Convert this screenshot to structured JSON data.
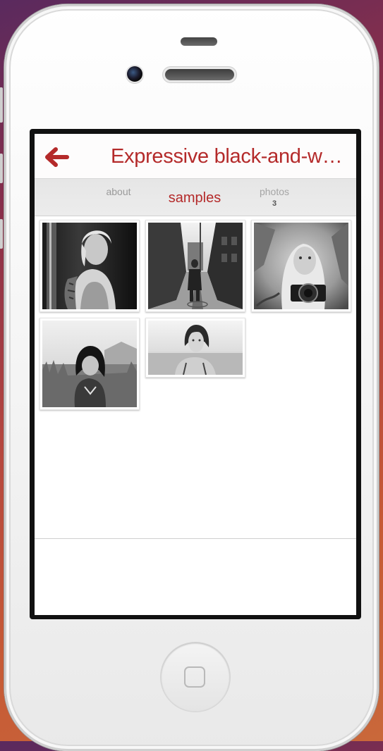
{
  "header": {
    "title": "Expressive black-and-white portraits",
    "back_icon": "back-arrow-icon",
    "accent_color": "#b42a2a"
  },
  "tabs": [
    {
      "label": "about",
      "selected": false
    },
    {
      "label": "samples",
      "selected": true
    },
    {
      "label": "photos",
      "count": "3",
      "selected": false
    }
  ],
  "samples": {
    "photos": [
      {
        "subject": "portrait-woman-tattoo"
      },
      {
        "subject": "woman-snowy-alley"
      },
      {
        "subject": "woman-with-camera"
      },
      {
        "subject": "girl-in-field"
      },
      {
        "subject": "woman-portrait-landscape"
      }
    ]
  },
  "device": {
    "home_button_icon": "home-square-icon"
  }
}
